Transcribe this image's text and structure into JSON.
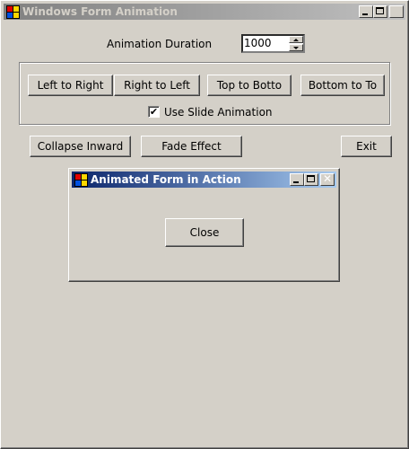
{
  "main_window": {
    "title": "Windows Form Animation",
    "duration_label": "Animation Duration",
    "duration_value": "1000",
    "direction_buttons": [
      "Left to Right",
      "Right to Left",
      "Top to Botto",
      "Bottom to To"
    ],
    "slide_checkbox": {
      "label": "Use Slide Animation",
      "checked": true,
      "check_glyph": "✔"
    },
    "collapse_label": "Collapse Inward",
    "fade_label": "Fade Effect",
    "exit_label": "Exit",
    "caption_close_glyph": "✕"
  },
  "child_window": {
    "title": "Animated Form in Action",
    "close_label": "Close",
    "caption_close_glyph": "✕"
  },
  "colors": {
    "face": "#d4d0c8",
    "active_title_start": "#0a246a",
    "active_title_end": "#a6caf0",
    "inactive_title_start": "#808080",
    "inactive_title_end": "#c0c0c0"
  }
}
